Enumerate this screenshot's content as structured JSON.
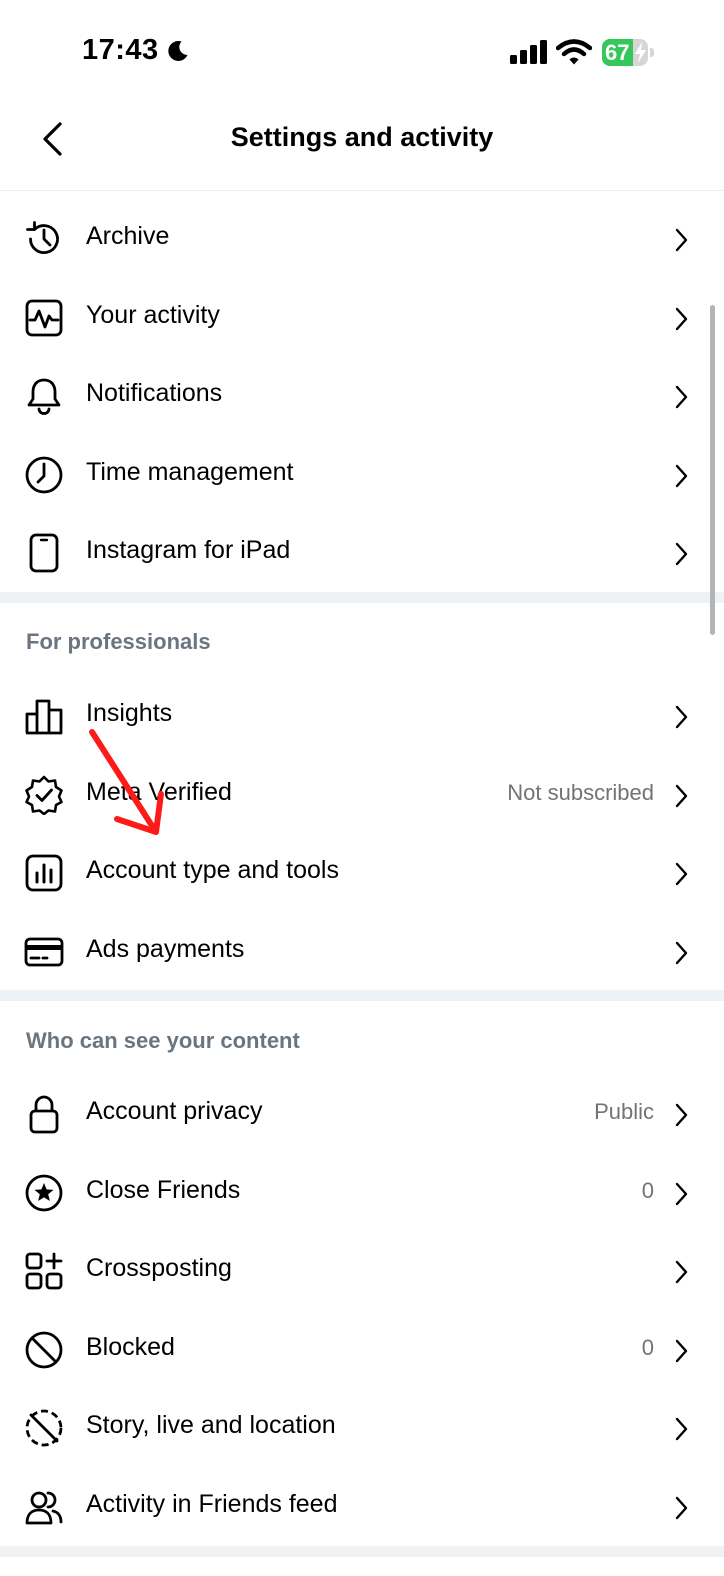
{
  "status_bar": {
    "time": "17:43",
    "battery": "67",
    "battery_level": 0.67,
    "moon_icon": "moon-icon",
    "signal_icon": "cellular-signal-icon",
    "wifi_icon": "wifi-icon"
  },
  "header": {
    "title": "Settings and activity",
    "back_icon": "chevron-left-icon"
  },
  "sections": {
    "activity": {
      "items": [
        {
          "label": "Archive",
          "icon": "archive-icon"
        },
        {
          "label": "Your activity",
          "icon": "activity-icon"
        },
        {
          "label": "Notifications",
          "icon": "bell-icon"
        },
        {
          "label": "Time management",
          "icon": "clock-icon"
        },
        {
          "label": "Instagram for iPad",
          "icon": "tablet-icon"
        }
      ]
    },
    "professionals": {
      "title": "For professionals",
      "items": [
        {
          "label": "Insights",
          "icon": "bar-chart-icon"
        },
        {
          "label": "Meta Verified",
          "value": "Not subscribed",
          "icon": "verified-badge-icon"
        },
        {
          "label": "Account type and tools",
          "icon": "chart-box-icon"
        },
        {
          "label": "Ads payments",
          "icon": "credit-card-icon"
        }
      ]
    },
    "content": {
      "title": "Who can see your content",
      "items": [
        {
          "label": "Account privacy",
          "value": "Public",
          "icon": "lock-icon"
        },
        {
          "label": "Close Friends",
          "value": "0",
          "icon": "star-circle-icon"
        },
        {
          "label": "Crossposting",
          "icon": "grid-plus-icon"
        },
        {
          "label": "Blocked",
          "value": "0",
          "icon": "blocked-icon"
        },
        {
          "label": "Story, live and location",
          "icon": "story-off-icon"
        },
        {
          "label": "Activity in Friends feed",
          "icon": "people-icon"
        }
      ]
    }
  },
  "colors": {
    "accent_green": "#34c759",
    "secondary_text": "#737373",
    "section_header": "#6b7580",
    "separator": "#eff2f5",
    "annotation_red": "#ff1a1a"
  }
}
